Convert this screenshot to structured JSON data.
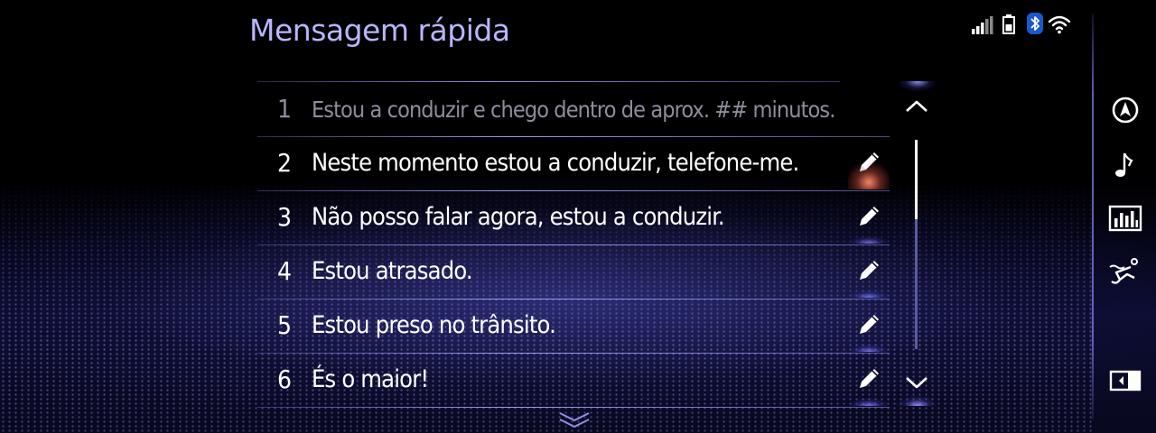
{
  "header": {
    "title": "Mensagem rápida"
  },
  "status_bar": {
    "icons": [
      "signal-strength-icon",
      "battery-icon",
      "bluetooth-icon",
      "wifi-icon"
    ]
  },
  "messages": [
    {
      "number": "1",
      "text": "Estou a conduzir e chego dentro de aprox. ## minutos.",
      "editable": false
    },
    {
      "number": "2",
      "text": "Neste momento estou a conduzir, telefone-me.",
      "editable": true
    },
    {
      "number": "3",
      "text": "Não posso falar agora, estou a conduzir.",
      "editable": true
    },
    {
      "number": "4",
      "text": "Estou atrasado.",
      "editable": true
    },
    {
      "number": "5",
      "text": "Estou preso no trânsito.",
      "editable": true
    },
    {
      "number": "6",
      "text": "És o maior!",
      "editable": true
    }
  ],
  "scrollbar": {
    "thumb_fraction": 0.38,
    "thumb_start": 0.0
  },
  "sidebar": {
    "items": [
      "navigation-icon",
      "music-note-icon",
      "audio-equalizer-icon",
      "seat-climate-icon",
      "display-toggle-icon"
    ]
  },
  "colors": {
    "title": "#b9b5ff",
    "accent_glow": "#8c8cff",
    "active_glow": "#ff8c6e"
  }
}
